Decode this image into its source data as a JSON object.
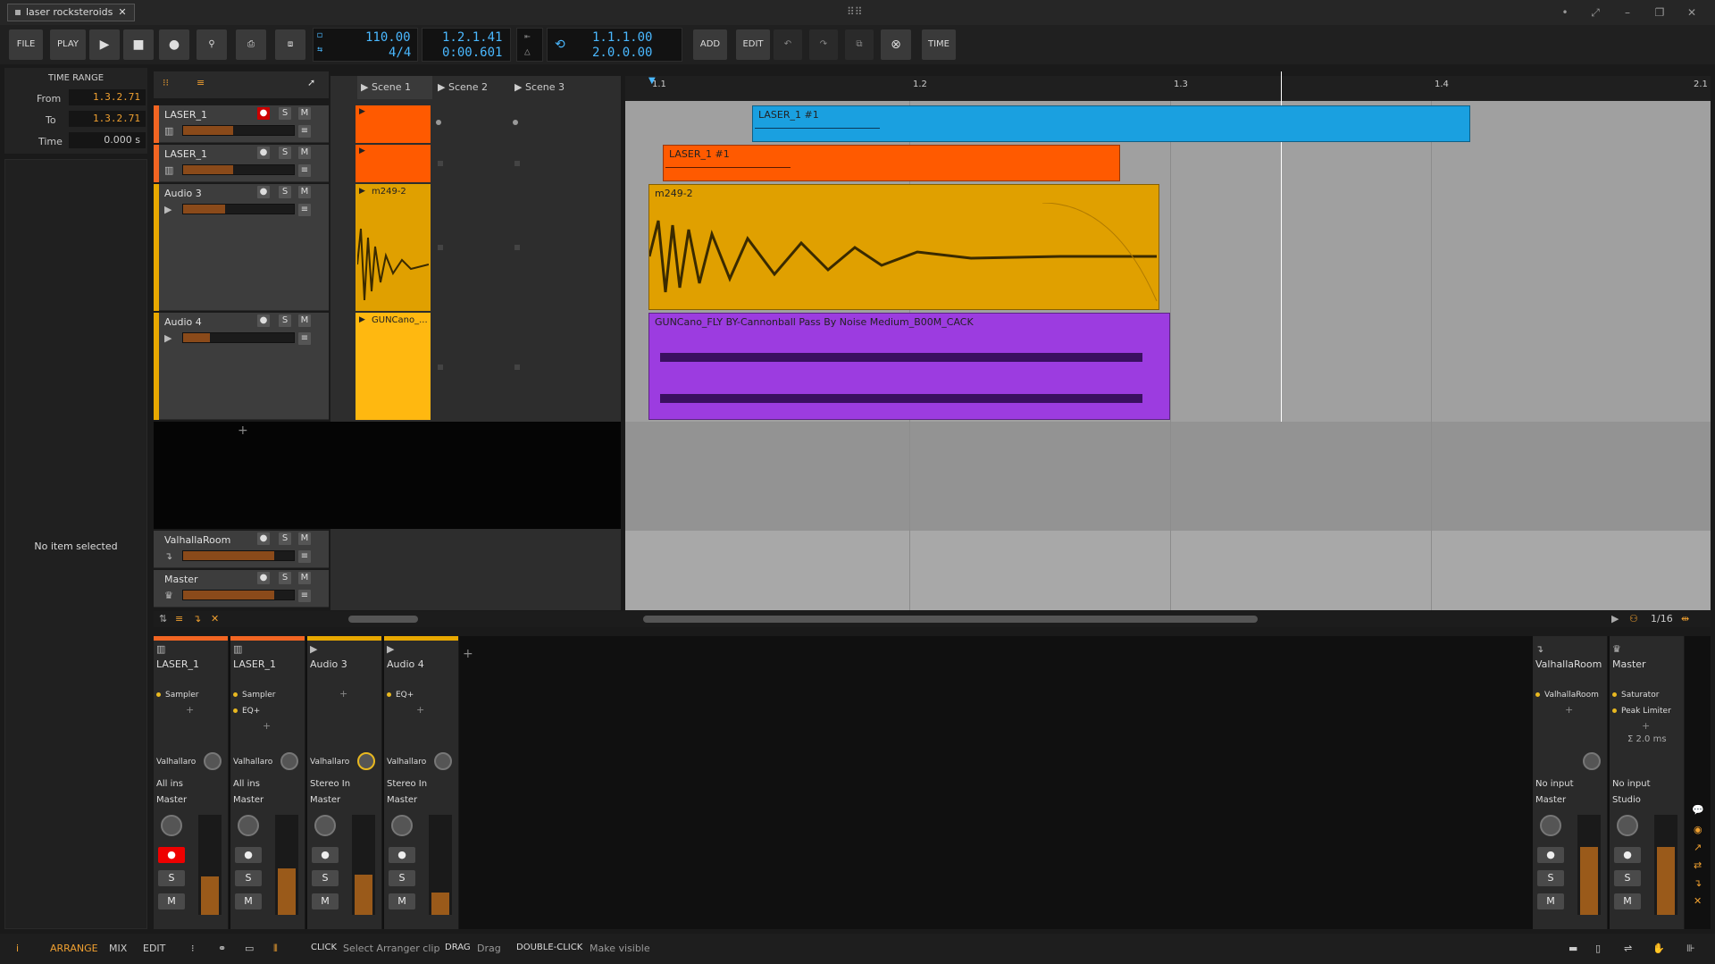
{
  "window": {
    "doc_tab": "laser rocksteroids"
  },
  "toolbar": {
    "file": "FILE",
    "play": "PLAY",
    "add": "ADD",
    "edit": "EDIT",
    "time": "TIME",
    "tempo": "110.00",
    "signature": "4/4",
    "position_bars": "1.2.1.41",
    "position_time": "0:00.601",
    "loop_start": "1.1.1.00",
    "loop_length": "2.0.0.00"
  },
  "inspector": {
    "title": "TIME RANGE",
    "from_label": "From",
    "from_value": "1.3.2.71",
    "to_label": "To",
    "to_value": "1.3.2.71",
    "time_label": "Time",
    "time_value": "0.000 s",
    "empty_text": "No item selected"
  },
  "scenes": [
    "Scene 1",
    "Scene 2",
    "Scene 3"
  ],
  "ruler": [
    "1.1",
    "1.2",
    "1.3",
    "1.4",
    "2.1"
  ],
  "tracks": [
    {
      "name": "LASER_1",
      "color": "#f26522",
      "clip_launcher": "",
      "clip": "LASER_1 #1",
      "clip_color": "#1aa0e0"
    },
    {
      "name": "LASER_1",
      "color": "#f26522",
      "clip_launcher": "",
      "clip": "LASER_1 #1",
      "clip_color": "#ff5a00"
    },
    {
      "name": "Audio 3",
      "color": "#e8a800",
      "clip_launcher": "m249-2",
      "clip": "m249-2",
      "clip_color": "#e0a000"
    },
    {
      "name": "Audio 4",
      "color": "#e8a800",
      "clip_launcher": "GUNCano_...",
      "clip": "GUNCano_FLY BY-Cannonball Pass By Noise Medium_B00M_CACK",
      "clip_color": "#9c3ce0"
    }
  ],
  "fx_tracks": [
    {
      "name": "ValhallaRoom"
    },
    {
      "name": "Master"
    }
  ],
  "bottom_bar": {
    "zoom": "1/16"
  },
  "mixer": {
    "strips": [
      {
        "name": "LASER_1",
        "devices": [
          "Sampler"
        ],
        "send": "Valhallaro",
        "input": "All ins",
        "output": "Master",
        "top_color": "#f26522"
      },
      {
        "name": "LASER_1",
        "devices": [
          "Sampler",
          "EQ+"
        ],
        "send": "Valhallaro",
        "input": "All ins",
        "output": "Master",
        "top_color": "#f26522"
      },
      {
        "name": "Audio 3",
        "devices": [],
        "send": "Valhallaro",
        "input": "Stereo In",
        "output": "Master",
        "top_color": "#e8a800"
      },
      {
        "name": "Audio 4",
        "devices": [
          "EQ+"
        ],
        "send": "Valhallaro",
        "input": "Stereo In",
        "output": "Master",
        "top_color": "#e8a800"
      }
    ],
    "fx": [
      {
        "name": "ValhallaRoom",
        "devices": [
          "ValhallaRoom"
        ],
        "input": "No input",
        "output": "Master"
      },
      {
        "name": "Master",
        "devices": [
          "Saturator",
          "Peak Limiter"
        ],
        "input": "No input",
        "output": "Studio",
        "latency": "Σ 2.0 ms"
      }
    ],
    "s": "S",
    "m": "M"
  },
  "status": {
    "tabs": [
      "ARRANGE",
      "MIX",
      "EDIT"
    ],
    "click_key": "CLICK",
    "click_desc": "Select Arranger clip",
    "drag_key": "DRAG",
    "drag_desc": "Drag",
    "dbl_key": "DOUBLE-CLICK",
    "dbl_desc": "Make visible"
  }
}
